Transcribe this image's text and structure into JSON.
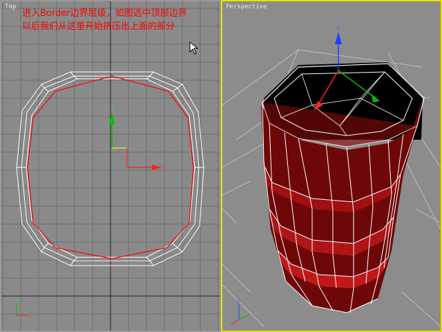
{
  "viewports": {
    "top": {
      "label": "Top"
    },
    "perspective": {
      "label": "Perspective"
    }
  },
  "annotation": {
    "line1": "进入Border边界层级，如图选中顶部边界",
    "line2": "以后我们从这里开始挤压出上面的部分"
  },
  "gizmo": {
    "x": "x",
    "y": "y",
    "z": "z"
  },
  "colors": {
    "top_viewport_bg": "#8a8a8a",
    "perspective_bg": "#8c8c8c",
    "active_border": "#e8e000",
    "selection_red": "#ff0000",
    "object_red": "#8b0a0a",
    "wire_white": "#ffffff",
    "grid_line": "#6e6e6e"
  },
  "icons": [
    "mouse-cursor-icon",
    "transform-gizmo-icon",
    "world-axis-icon"
  ]
}
